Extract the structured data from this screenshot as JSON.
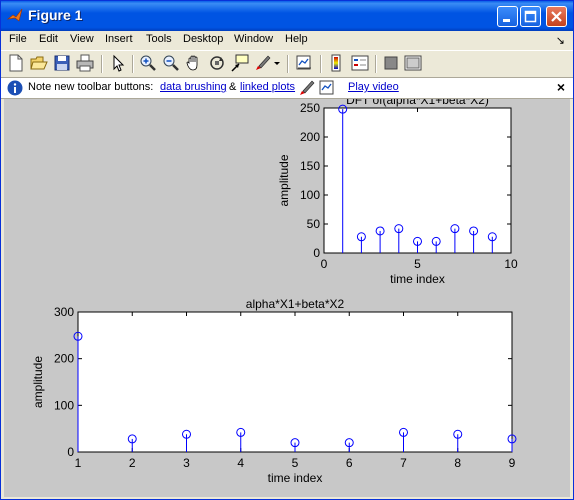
{
  "window": {
    "title": "Figure 1",
    "controls": [
      "minimize",
      "maximize",
      "close"
    ]
  },
  "menu": {
    "items": [
      "File",
      "Edit",
      "View",
      "Insert",
      "Tools",
      "Desktop",
      "Window",
      "Help"
    ]
  },
  "toolbar": {
    "tools": [
      "new-figure-icon",
      "open-file-icon",
      "save-icon",
      "print-icon",
      "pointer-icon",
      "zoom-in-icon",
      "zoom-out-icon",
      "pan-hand-icon",
      "rotate-3d-icon",
      "data-cursor-icon",
      "brush-icon",
      "dropdown-arrow-icon",
      "link-plot-icon",
      "colorbar-icon",
      "legend-icon",
      "hide-tools-icon",
      "show-tools-icon"
    ]
  },
  "infobar": {
    "prefix": "Note new toolbar buttons:",
    "link1": "data brushing",
    "amp": "&",
    "link2": "linked plots",
    "video": "Play video",
    "close": "×"
  },
  "chart_data": [
    {
      "type": "stem",
      "title": "DFT of(alpha*X1+beta*X2)",
      "xlabel": "time index",
      "ylabel": "amplitude",
      "xlim": [
        0,
        10
      ],
      "ylim": [
        0,
        250
      ],
      "xticks": [
        "0",
        "5",
        "10"
      ],
      "yticks": [
        "0",
        "50",
        "100",
        "150",
        "200",
        "250"
      ],
      "x": [
        1,
        2,
        3,
        4,
        5,
        6,
        7,
        8,
        9
      ],
      "values": [
        248,
        28,
        38,
        42,
        20,
        20,
        42,
        38,
        28
      ],
      "color": "#0000ff"
    },
    {
      "type": "stem",
      "title": "alpha*X1+beta*X2",
      "xlabel": "time index",
      "ylabel": "amplitude",
      "xlim": [
        1,
        9
      ],
      "ylim": [
        0,
        300
      ],
      "xticks": [
        "1",
        "2",
        "3",
        "4",
        "5",
        "6",
        "7",
        "8",
        "9"
      ],
      "yticks": [
        "0",
        "100",
        "200",
        "300"
      ],
      "x": [
        1,
        2,
        3,
        4,
        5,
        6,
        7,
        8,
        9
      ],
      "values": [
        248,
        28,
        38,
        42,
        20,
        20,
        42,
        38,
        28
      ],
      "color": "#0000ff"
    }
  ]
}
